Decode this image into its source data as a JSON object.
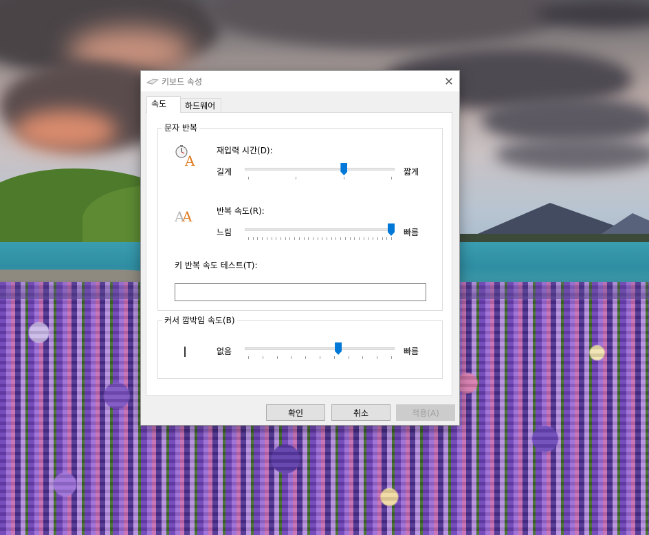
{
  "window": {
    "title": "키보드 속성",
    "close_glyph": "✕"
  },
  "tabs": [
    {
      "label": "속도",
      "active": true
    },
    {
      "label": "하드웨어",
      "active": false
    }
  ],
  "repeat_group": {
    "title": "문자 반복",
    "delay": {
      "label": "재입력 시간(D):",
      "min_label": "길게",
      "max_label": "짧게",
      "value_fraction": 0.67,
      "tick_count": 4
    },
    "rate": {
      "label": "반복 속도(R):",
      "min_label": "느림",
      "max_label": "빠름",
      "value_fraction": 1.0,
      "tick_count": 32
    },
    "test_label": "키 반복 속도 테스트(T):",
    "test_value": ""
  },
  "cursor_group": {
    "title": "커서 깜박임 속도(B)",
    "min_label": "없음",
    "max_label": "빠름",
    "value_fraction": 0.63,
    "tick_count": 11
  },
  "buttons": {
    "ok": "확인",
    "cancel": "취소",
    "apply": "적용(A)"
  },
  "colors": {
    "accent": "#0078d7",
    "dialog_bg": "#f0f0f0",
    "panel_bg": "#ffffff"
  }
}
